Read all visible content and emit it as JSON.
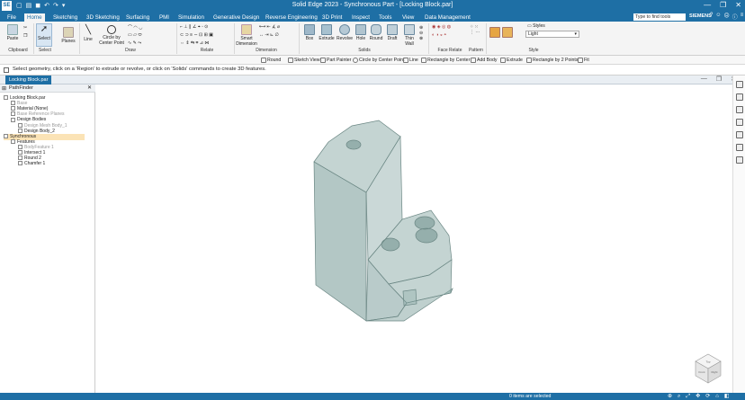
{
  "window": {
    "title": "Solid Edge 2023 - Synchronous Part - [Locking Block.par]",
    "app_logo": "SE",
    "brand": "SIEMENS",
    "min": "—",
    "max": "❐",
    "close": "✕"
  },
  "tabs": [
    "File",
    "Home",
    "Sketching",
    "3D Sketching",
    "Surfacing",
    "PMI",
    "Simulation",
    "Generative Design",
    "Reverse Engineering",
    "3D Print",
    "Inspect",
    "Tools",
    "View",
    "Data Management"
  ],
  "search": {
    "placeholder": "Type to find tools"
  },
  "ribbon": {
    "clipboard": {
      "paste": "Paste",
      "group": "Clipboard"
    },
    "select": {
      "label": "Select",
      "group": "Select"
    },
    "planes": {
      "label": "Planes"
    },
    "draw": {
      "line": "Line",
      "circle": "Circle by Center Point",
      "group": "Draw"
    },
    "relate": {
      "group": "Relate"
    },
    "dimension": {
      "smart": "Smart Dimension",
      "group": "Dimension"
    },
    "solids": {
      "box": "Box",
      "extrude": "Extrude",
      "revolve": "Revolve",
      "hole": "Hole",
      "round": "Round",
      "draft": "Draft",
      "thinwall": "Thin Wall",
      "group": "Solids"
    },
    "face_relate": {
      "group": "Face Relate"
    },
    "pattern": {
      "group": "Pattern"
    },
    "style": {
      "styles_label": "Styles",
      "style_value": "Light",
      "group": "Style"
    }
  },
  "command_bar": [
    "Round",
    "Sketch View",
    "Part Painter",
    "Circle by Center Point",
    "Line",
    "Rectangle by Center",
    "Add Body",
    "Extrude",
    "Rectangle by 2 Points",
    "Fit"
  ],
  "prompt": "Select geometry, click on a 'Region' to extrude or revolve, or click on 'Solids' commands to create 3D features.",
  "doc_tab": "Locking Block.par",
  "pathfinder": {
    "title": "PathFinder",
    "tree": [
      {
        "label": "Locking Block.par",
        "dim": false,
        "sel": false
      },
      {
        "label": "Base",
        "dim": true,
        "sel": false
      },
      {
        "label": "Material (None)",
        "dim": false,
        "sel": false
      },
      {
        "label": "Base Reference Planes",
        "dim": true,
        "sel": false
      },
      {
        "label": "Design Bodies",
        "dim": false,
        "sel": false
      },
      {
        "label": "Design Mesh Body_1",
        "dim": true,
        "sel": false
      },
      {
        "label": "Design Body_2",
        "dim": false,
        "sel": false
      },
      {
        "label": "Synchronous",
        "dim": false,
        "sel": true
      },
      {
        "label": "Features",
        "dim": false,
        "sel": false
      },
      {
        "label": "BodyFeature 1",
        "dim": true,
        "sel": false
      },
      {
        "label": "Intersect 1",
        "dim": false,
        "sel": false
      },
      {
        "label": "Round 2",
        "dim": false,
        "sel": false
      },
      {
        "label": "Chamfer 1",
        "dim": false,
        "sel": false
      }
    ]
  },
  "viewcube": {
    "front": "Front",
    "right": "Right",
    "top": "Top"
  },
  "status": {
    "selection": "0 items are selected"
  },
  "colors": {
    "accent": "#1e6fa5",
    "model": "#8aa9a6",
    "model_edge": "#6b8784"
  }
}
